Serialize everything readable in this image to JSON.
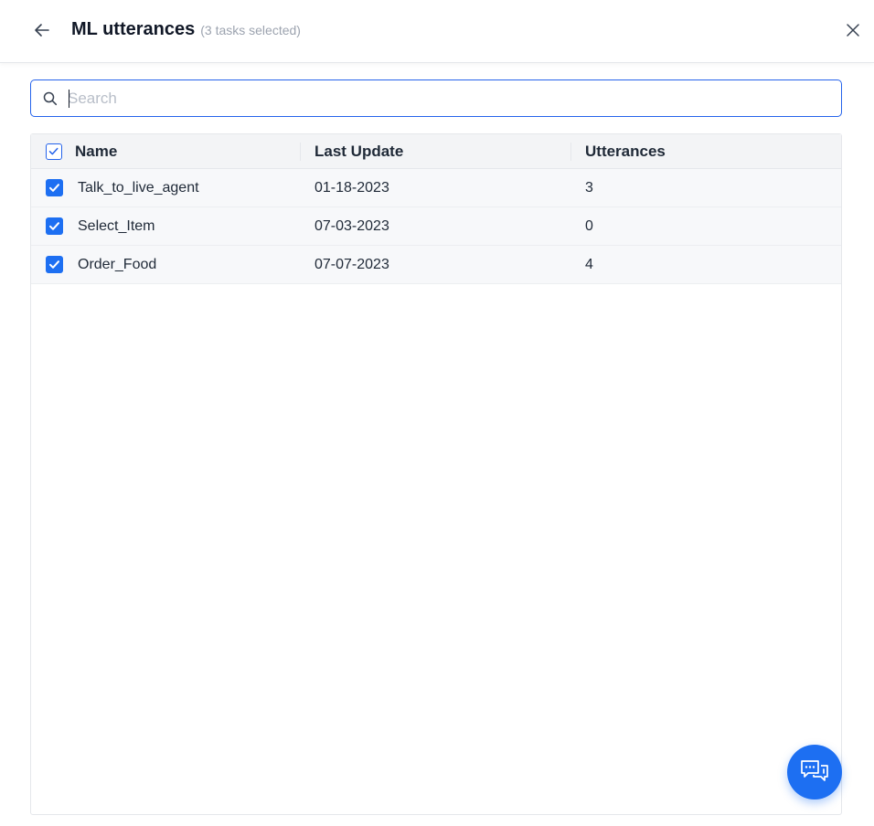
{
  "header": {
    "title": "ML utterances",
    "subtitle": "(3 tasks selected)",
    "back_icon": "arrow-left-icon",
    "close_icon": "close-icon"
  },
  "search": {
    "placeholder": "Search",
    "value": ""
  },
  "table": {
    "columns": [
      "Name",
      "Last Update",
      "Utterances"
    ],
    "select_all_checked": true,
    "rows": [
      {
        "checked": true,
        "name": "Talk_to_live_agent",
        "last_update": "01-18-2023",
        "utterances": "3"
      },
      {
        "checked": true,
        "name": "Select_Item",
        "last_update": "07-03-2023",
        "utterances": "0"
      },
      {
        "checked": true,
        "name": "Order_Food",
        "last_update": "07-07-2023",
        "utterances": "4"
      }
    ]
  },
  "chat": {
    "icon": "chat-bubbles-icon"
  },
  "colors": {
    "accent": "#1d6ff2",
    "focus_border": "#2563eb",
    "header_bg": "#f3f4f6",
    "row_bg": "#f7f8fa"
  }
}
